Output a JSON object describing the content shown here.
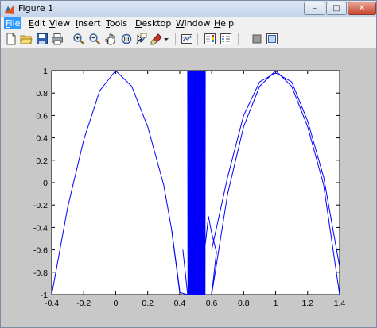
{
  "window": {
    "title": "Figure 1"
  },
  "title_buttons": {
    "minimize": "–",
    "maximize": "□",
    "close": "✕"
  },
  "menu": {
    "items": [
      {
        "label": "File",
        "key": "F",
        "rest": "ile"
      },
      {
        "label": "Edit",
        "key": "E",
        "rest": "dit"
      },
      {
        "label": "View",
        "key": "V",
        "rest": "iew"
      },
      {
        "label": "Insert",
        "key": "I",
        "rest": "nsert"
      },
      {
        "label": "Tools",
        "key": "T",
        "rest": "ools"
      },
      {
        "label": "Desktop",
        "key": "D",
        "rest": "esktop"
      },
      {
        "label": "Window",
        "key": "W",
        "rest": "indow"
      },
      {
        "label": "Help",
        "key": "H",
        "rest": "elp"
      }
    ],
    "active_index": 0
  },
  "toolbar": {
    "icons": [
      "new-figure-icon",
      "open-file-icon",
      "save-icon",
      "print-icon",
      "zoom-in-icon",
      "zoom-out-icon",
      "pan-icon",
      "rotate-3d-icon",
      "data-cursor-icon",
      "brush-icon",
      "brush-dropdown-icon",
      "link-plot-icon",
      "insert-colorbar-icon",
      "insert-legend-icon",
      "hide-plot-tools-icon",
      "show-plot-tools-icon"
    ]
  },
  "chart_data": {
    "type": "line",
    "title": "",
    "xlabel": "",
    "ylabel": "",
    "xlim": [
      -0.4,
      1.4
    ],
    "ylim": [
      -1,
      1
    ],
    "xticks": [
      "-0.4",
      "-0.2",
      "0",
      "0.2",
      "0.4",
      "0.6",
      "0.8",
      "1",
      "1.2",
      "1.4"
    ],
    "yticks": [
      "1",
      "0.8",
      "0.6",
      "0.4",
      "0.2",
      "0",
      "-0.2",
      "-0.4",
      "-0.6",
      "-0.8",
      "-1"
    ],
    "grid": false,
    "series": [
      {
        "color": "#0000ff",
        "description_points": {
          "left_arch": [
            [
              -0.4,
              -1
            ],
            [
              -0.3,
              -0.22
            ],
            [
              -0.2,
              0.38
            ],
            [
              -0.1,
              0.82
            ],
            [
              0,
              1
            ],
            [
              0.1,
              0.86
            ],
            [
              0.2,
              0.5
            ],
            [
              0.3,
              -0.02
            ],
            [
              0.35,
              -0.42
            ],
            [
              0.4,
              -0.96
            ]
          ],
          "oscillation_x_range": [
            0.45,
            0.56
          ],
          "right_arch": [
            [
              0.6,
              -1
            ],
            [
              0.7,
              -0.1
            ],
            [
              0.8,
              0.5
            ],
            [
              0.9,
              0.86
            ],
            [
              1,
              1
            ],
            [
              1.1,
              0.86
            ],
            [
              1.2,
              0.5
            ],
            [
              1.3,
              -0.02
            ],
            [
              1.4,
              -1
            ]
          ],
          "right_arch_shadow": [
            [
              0.6,
              -0.6
            ],
            [
              0.7,
              0.05
            ],
            [
              0.8,
              0.6
            ],
            [
              0.9,
              0.9
            ],
            [
              1.0,
              0.98
            ],
            [
              1.1,
              0.9
            ],
            [
              1.2,
              0.55
            ],
            [
              1.3,
              0.05
            ],
            [
              1.4,
              -0.75
            ]
          ]
        }
      }
    ]
  }
}
